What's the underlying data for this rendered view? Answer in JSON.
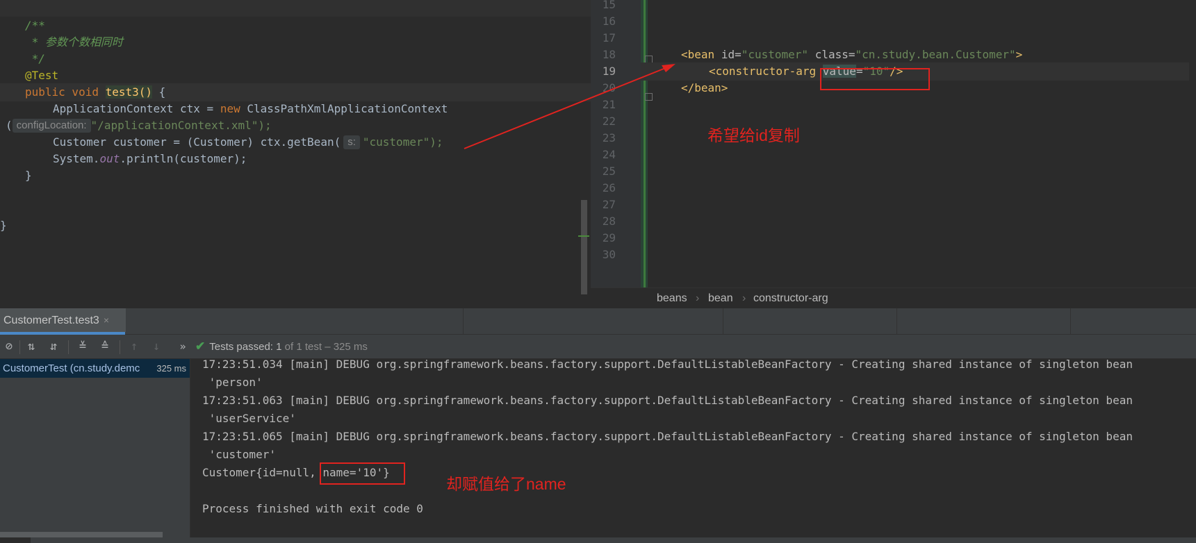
{
  "left_editor": {
    "lines": [
      "/**",
      " * 参数个数相同时",
      " */",
      "@Test",
      "public void test3() {",
      "ApplicationContext ctx = new ClassPathXmlApplicationContext",
      "configLocation:",
      "\"/applicationContext.xml\");",
      "Customer customer = (Customer) ctx.getBean(",
      "s:",
      "\"customer\");",
      "System.out.println(customer);",
      "}",
      "}"
    ]
  },
  "xml_editor": {
    "line_numbers": [
      "15",
      "16",
      "17",
      "18",
      "19",
      "20",
      "21",
      "22",
      "23",
      "24",
      "25",
      "26",
      "27",
      "28",
      "29",
      "30"
    ],
    "active_line": "19",
    "bean_open": {
      "tag": "<bean",
      "id_attr": "id=",
      "id_val": "\"customer\"",
      "class_attr": "class=",
      "class_val": "\"cn.study.bean.Customer\"",
      "close": ">"
    },
    "ctor_arg": {
      "tag": "<constructor-arg",
      "attr": "value",
      "eq": "=",
      "val": "\"10\"",
      "close": "/>"
    },
    "bean_close": "</bean>",
    "breadcrumb": [
      "beans",
      "bean",
      "constructor-arg"
    ],
    "breadcrumb_sep": "›"
  },
  "annotations": {
    "note_top": "希望给id复制",
    "note_bottom": "却赋值给了name",
    "color": "#e1231f"
  },
  "run_panel": {
    "tab_label": "CustomerTest.test3",
    "tab_close": "×",
    "tests_status": "Tests passed: 1",
    "tests_detail": "of 1 test – 325 ms",
    "tree_item": "CustomerTest (cn.study.demc",
    "tree_time": "325 ms",
    "console_lines": [
      "17:23:51.034 [main] DEBUG org.springframework.beans.factory.support.DefaultListableBeanFactory - Creating shared instance of singleton bean",
      " 'person'",
      "17:23:51.063 [main] DEBUG org.springframework.beans.factory.support.DefaultListableBeanFactory - Creating shared instance of singleton bean",
      " 'userService'",
      "17:23:51.065 [main] DEBUG org.springframework.beans.factory.support.DefaultListableBeanFactory - Creating shared instance of singleton bean",
      " 'customer'",
      "Customer{id=null,",
      " name='10'}",
      "",
      "Process finished with exit code 0"
    ],
    "toolbar_icons": [
      "stop-icon",
      "sort-alpha-icon",
      "sort-duration-icon",
      "expand-all-icon",
      "collapse-all-icon",
      "prev-failed-icon",
      "next-failed-icon",
      "more-icon",
      "check-icon"
    ]
  }
}
